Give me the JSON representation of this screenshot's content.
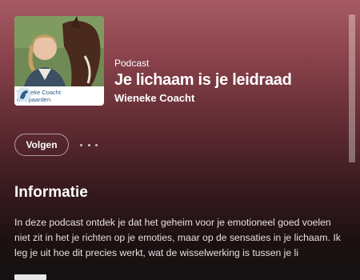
{
  "header": {
    "kind_label": "Podcast",
    "title": "Je lichaam is je leidraad",
    "author": "Wieneke Coacht",
    "cover": {
      "badge_line1": "Wieneke Coacht",
      "badge_line2": "met paarden",
      "icon": "horse-logo-icon"
    }
  },
  "actions": {
    "follow_label": "Volgen",
    "more_icon": "more-options-icon"
  },
  "info": {
    "heading": "Informatie",
    "description": "In deze podcast ontdek je dat het geheim voor je emotioneel goed voelen niet zit in het je richten op je emoties, maar op de sensaties in je lichaam. Ik leg je uit hoe dit precies werkt, wat de wisselwerking is tussen je li"
  },
  "colors": {
    "accent": "#a65a63",
    "background_dark": "#141212"
  }
}
